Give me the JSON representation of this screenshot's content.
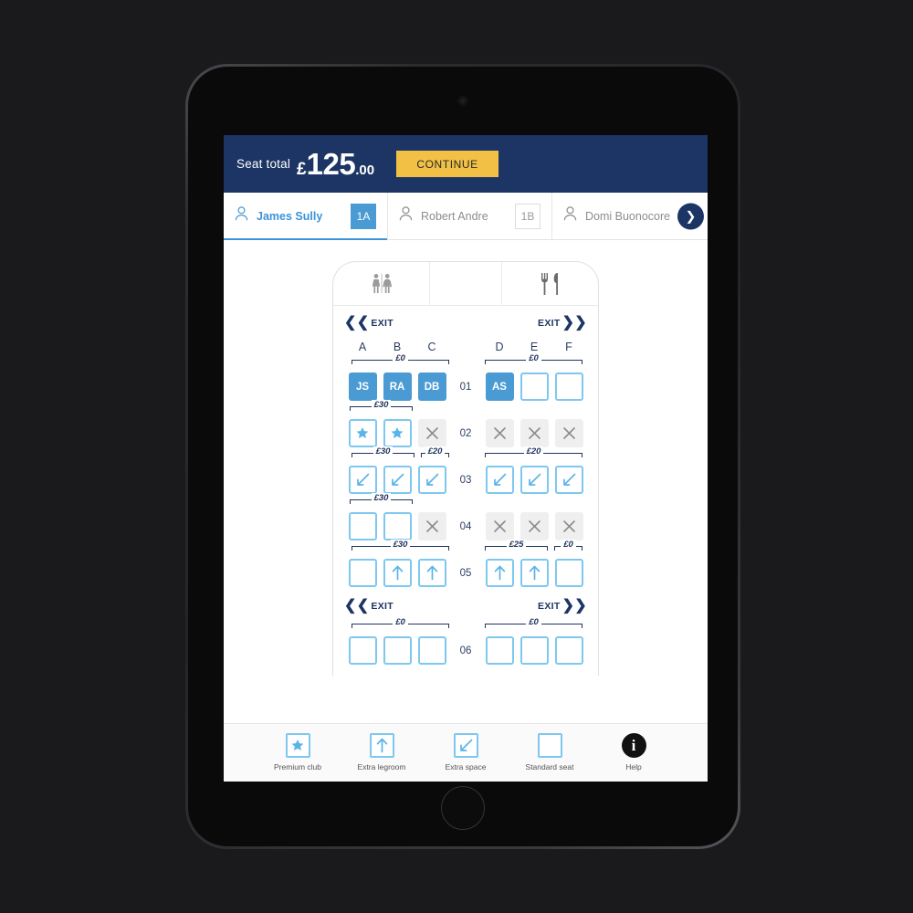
{
  "header": {
    "seat_total_label": "Seat total",
    "currency": "£",
    "amount_major": "125",
    "amount_minor": ".00",
    "continue_label": "CONTINUE",
    "bg_color": "#1c3564",
    "continue_color": "#f2c044"
  },
  "passengers": [
    {
      "name": "James Sully",
      "seat": "1A",
      "active": true
    },
    {
      "name": "Robert Andre",
      "seat": "1B",
      "active": false
    },
    {
      "name": "Domi Buonocore",
      "seat": "",
      "active": false
    }
  ],
  "tabs_next_icon": "chevron-right-icon",
  "cabin": {
    "lavatory_icon": "lavatory-icon",
    "galley_icon": "galley-icon",
    "exit_label": "EXIT",
    "columns_left": [
      "A",
      "B",
      "C"
    ],
    "columns_right": [
      "D",
      "E",
      "F"
    ],
    "rows": [
      {
        "number": "01",
        "prices_left": [
          {
            "label": "£0",
            "span": 3
          }
        ],
        "prices_right": [
          {
            "label": "£0",
            "span": 3
          }
        ],
        "seats_left": [
          {
            "state": "selected",
            "label": "JS"
          },
          {
            "state": "selected",
            "label": "RA"
          },
          {
            "state": "selected",
            "label": "DB"
          }
        ],
        "seats_right": [
          {
            "state": "selected",
            "label": "AS"
          },
          {
            "state": "available",
            "icon": "standard"
          },
          {
            "state": "available",
            "icon": "standard"
          }
        ]
      },
      {
        "number": "02",
        "prices_left": [
          {
            "label": "£30",
            "span": 2
          }
        ],
        "prices_right": [],
        "seats_left": [
          {
            "state": "available",
            "icon": "star"
          },
          {
            "state": "available",
            "icon": "star"
          },
          {
            "state": "unavailable",
            "icon": "cross"
          }
        ],
        "seats_right": [
          {
            "state": "unavailable",
            "icon": "cross"
          },
          {
            "state": "unavailable",
            "icon": "cross"
          },
          {
            "state": "unavailable",
            "icon": "cross"
          }
        ]
      },
      {
        "number": "03",
        "prices_left": [
          {
            "label": "£30",
            "span": 2
          },
          {
            "label": "£20",
            "span": 1
          }
        ],
        "prices_right": [
          {
            "label": "£20",
            "span": 3
          }
        ],
        "seats_left": [
          {
            "state": "available",
            "icon": "space"
          },
          {
            "state": "available",
            "icon": "space"
          },
          {
            "state": "available",
            "icon": "space"
          }
        ],
        "seats_right": [
          {
            "state": "available",
            "icon": "space"
          },
          {
            "state": "available",
            "icon": "space"
          },
          {
            "state": "available",
            "icon": "space"
          }
        ]
      },
      {
        "number": "04",
        "prices_left": [
          {
            "label": "£30",
            "span": 2
          }
        ],
        "prices_right": [],
        "seats_left": [
          {
            "state": "available",
            "icon": "standard"
          },
          {
            "state": "available",
            "icon": "standard"
          },
          {
            "state": "unavailable",
            "icon": "cross"
          }
        ],
        "seats_right": [
          {
            "state": "unavailable",
            "icon": "cross"
          },
          {
            "state": "unavailable",
            "icon": "cross"
          },
          {
            "state": "unavailable",
            "icon": "cross"
          }
        ]
      },
      {
        "number": "05",
        "prices_left": [
          {
            "label": "£30",
            "span": 3
          }
        ],
        "prices_right": [
          {
            "label": "£25",
            "span": 2
          },
          {
            "label": "£0",
            "span": 1
          }
        ],
        "seats_left": [
          {
            "state": "available",
            "icon": "standard"
          },
          {
            "state": "available",
            "icon": "legroom"
          },
          {
            "state": "available",
            "icon": "legroom"
          }
        ],
        "seats_right": [
          {
            "state": "available",
            "icon": "legroom"
          },
          {
            "state": "available",
            "icon": "legroom"
          },
          {
            "state": "available",
            "icon": "standard"
          }
        ]
      },
      {
        "number": "06",
        "prices_left": [
          {
            "label": "£0",
            "span": 3
          }
        ],
        "prices_right": [
          {
            "label": "£0",
            "span": 3
          }
        ],
        "seats_left": [
          {
            "state": "available",
            "icon": "standard"
          },
          {
            "state": "available",
            "icon": "standard"
          },
          {
            "state": "available",
            "icon": "standard"
          }
        ],
        "seats_right": [
          {
            "state": "available",
            "icon": "standard"
          },
          {
            "state": "available",
            "icon": "standard"
          },
          {
            "state": "available",
            "icon": "standard"
          }
        ]
      }
    ]
  },
  "legend": [
    {
      "label": "Premium club",
      "icon": "star"
    },
    {
      "label": "Extra legroom",
      "icon": "legroom"
    },
    {
      "label": "Extra space",
      "icon": "space"
    },
    {
      "label": "Standard seat",
      "icon": "standard"
    },
    {
      "label": "Help",
      "icon": "info"
    }
  ],
  "colors": {
    "navy": "#1c3564",
    "seat_blue": "#4a9ad4",
    "seat_outline": "#7ec8f0",
    "gold": "#f2c044",
    "unavailable": "#efefef"
  }
}
